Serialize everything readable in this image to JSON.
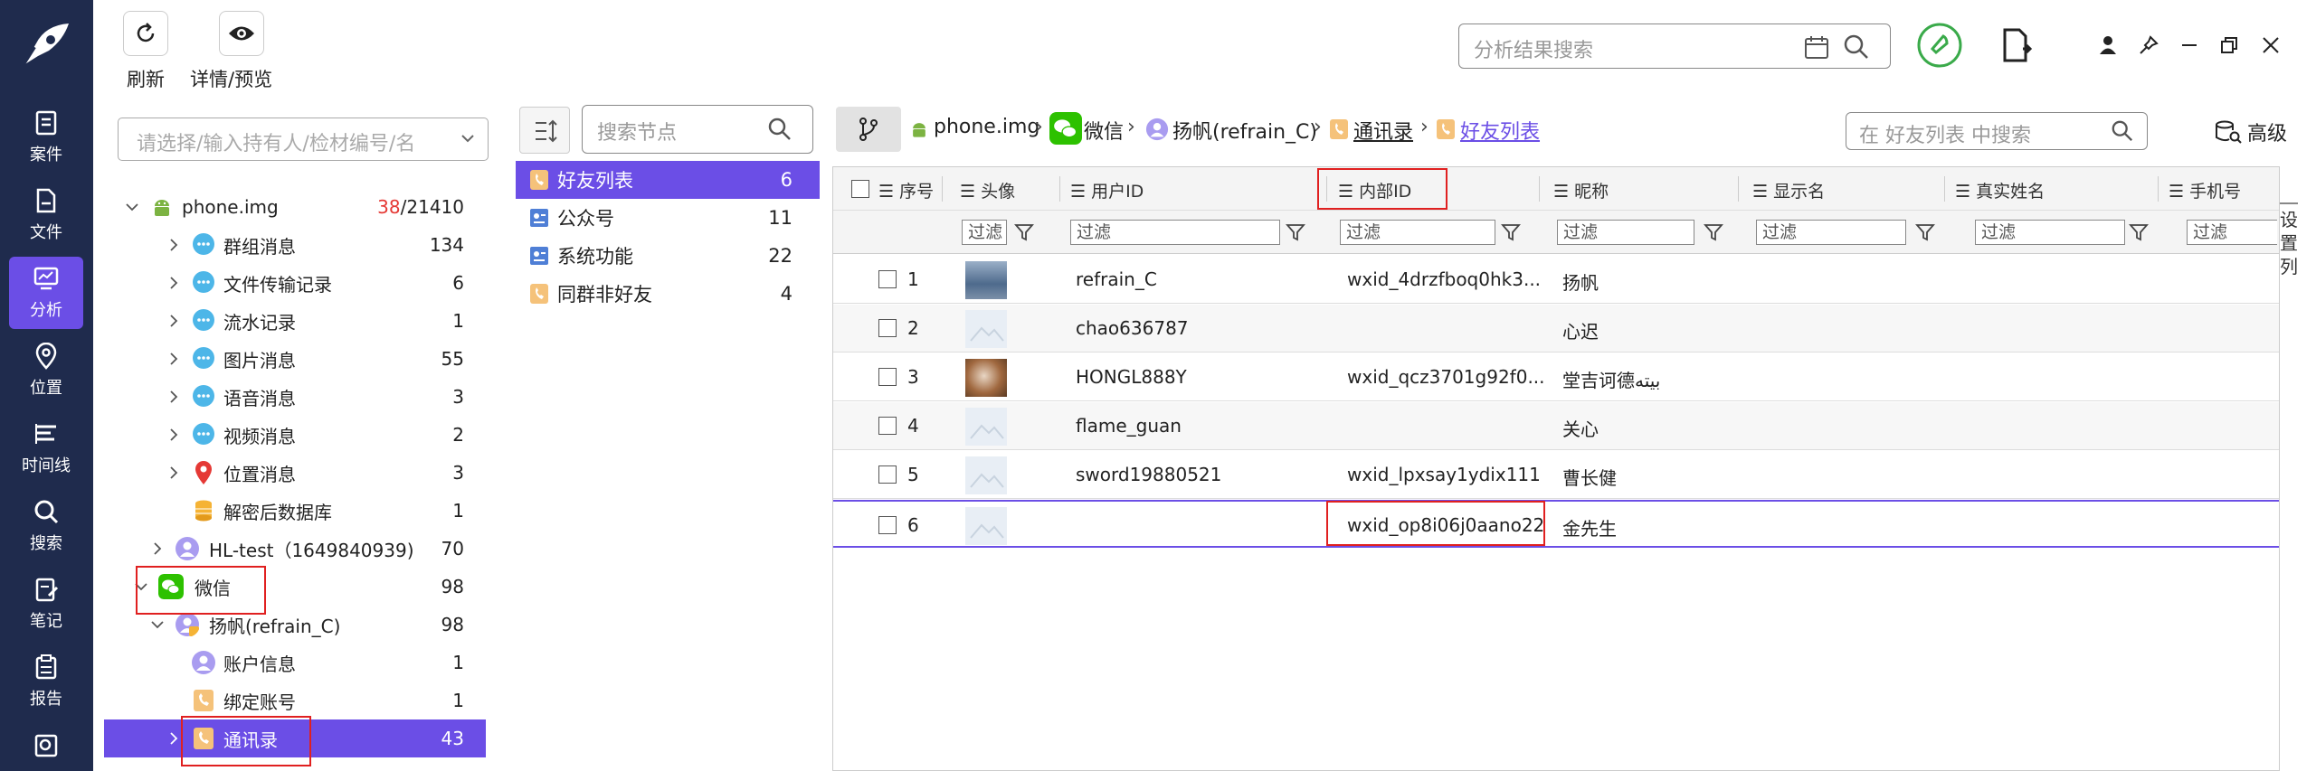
{
  "rail": {
    "items": [
      {
        "label": "案件",
        "icon": "case-icon"
      },
      {
        "label": "文件",
        "icon": "file-icon"
      },
      {
        "label": "分析",
        "icon": "analysis-icon"
      },
      {
        "label": "位置",
        "icon": "location-icon"
      },
      {
        "label": "时间线",
        "icon": "timeline-icon"
      },
      {
        "label": "搜索",
        "icon": "search-icon"
      },
      {
        "label": "笔记",
        "icon": "note-icon"
      },
      {
        "label": "报告",
        "icon": "report-icon"
      },
      {
        "label": "…",
        "icon": "more-icon"
      }
    ]
  },
  "toolbar": {
    "refresh": "刷新",
    "detail": "详情/预览"
  },
  "topsearch": {
    "placeholder": "分析结果搜索"
  },
  "owner": {
    "placeholder": "请选择/输入持有人/检材编号/名"
  },
  "tree": [
    {
      "label": "phone.img",
      "count_a": "38",
      "count_b": "/21410"
    },
    {
      "label": "群组消息",
      "count": "134"
    },
    {
      "label": "文件传输记录",
      "count": "6"
    },
    {
      "label": "流水记录",
      "count": "1"
    },
    {
      "label": "图片消息",
      "count": "55"
    },
    {
      "label": "语音消息",
      "count": "3"
    },
    {
      "label": "视频消息",
      "count": "2"
    },
    {
      "label": "位置消息",
      "count": "3"
    },
    {
      "label": "解密后数据库",
      "count": "1"
    },
    {
      "label": "HL-test（1649840939)",
      "count": "70"
    },
    {
      "label": "微信",
      "count": "98"
    },
    {
      "label": "扬帆(refrain_C)",
      "count": "98"
    },
    {
      "label": "账户信息",
      "count": "1"
    },
    {
      "label": "绑定账号",
      "count": "1"
    },
    {
      "label": "通讯录",
      "count": "43"
    }
  ],
  "nodes": {
    "placeholder": "搜索节点",
    "items": [
      {
        "label": "好友列表",
        "count": "6"
      },
      {
        "label": "公众号",
        "count": "11"
      },
      {
        "label": "系统功能",
        "count": "22"
      },
      {
        "label": "同群非好友",
        "count": "4"
      }
    ]
  },
  "breadcrumb": [
    "phone.img",
    "微信",
    "扬帆(refrain_C)",
    "通讯录",
    "好友列表"
  ],
  "gridsearch": {
    "placeholder": "在 好友列表 中搜索"
  },
  "advanced": "高级",
  "columns": [
    "序号",
    "头像",
    "用户ID",
    "内部ID",
    "昵称",
    "显示名",
    "真实姓名",
    "手机号"
  ],
  "filter_label": "过滤",
  "rows": [
    {
      "no": "1",
      "uid": "refrain_C",
      "iid": "wxid_4drzfboq0hk3...",
      "nick": "扬帆"
    },
    {
      "no": "2",
      "uid": "chao636787",
      "iid": "",
      "nick": "心迟"
    },
    {
      "no": "3",
      "uid": "HONGL888Y",
      "iid": "wxid_qcz3701g92f0...",
      "nick": "堂吉诃德بيته"
    },
    {
      "no": "4",
      "uid": "flame_guan",
      "iid": "",
      "nick": "关心"
    },
    {
      "no": "5",
      "uid": "sword19880521",
      "iid": "wxid_lpxsay1ydix111",
      "nick": "曹长健"
    },
    {
      "no": "6",
      "uid": "",
      "iid": "wxid_op8i06j0aano22",
      "nick": "金先生"
    }
  ],
  "settings": "设置列",
  "colors": {
    "accent": "#6b4ee6",
    "rail": "#1f2b4d",
    "highlight": "#e02020"
  }
}
